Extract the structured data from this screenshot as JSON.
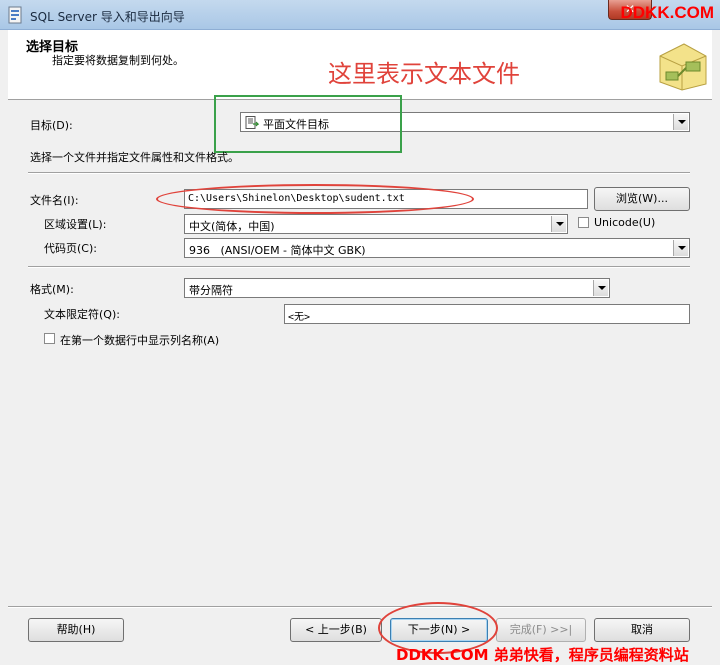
{
  "window": {
    "title": "SQL Server 导入和导出向导",
    "close_label": "✕"
  },
  "watermark": {
    "top": "DDKK.COM",
    "bottom": "DDKK.COM 弟弟快看，程序员编程资料站"
  },
  "header": {
    "title": "选择目标",
    "subtitle": "指定要将数据复制到何处。",
    "annotation": "这里表示文本文件"
  },
  "form": {
    "target_label": "目标(D):",
    "target_value": "平面文件目标",
    "instruction": "选择一个文件并指定文件属性和文件格式。",
    "filename_label": "文件名(I):",
    "filename_value": "C:\\Users\\Shinelon\\Desktop\\sudent.txt",
    "browse_label": "浏览(W)...",
    "locale_label": "区域设置(L):",
    "locale_value": "中文(简体，中国)",
    "unicode_label": "Unicode(U)",
    "codepage_label": "代码页(C):",
    "codepage_value": "936   (ANSI/OEM - 简体中文 GBK)",
    "format_label": "格式(M):",
    "format_value": "带分隔符",
    "qualifier_label": "文本限定符(Q):",
    "qualifier_value": "<无>",
    "header_row_label": "在第一个数据行中显示列名称(A)"
  },
  "buttons": {
    "help": "帮助(H)",
    "back": "< 上一步(B)",
    "next": "下一步(N) >",
    "finish": "完成(F) >>|",
    "cancel": "取消"
  },
  "colors": {
    "annotation_red": "#e0433b",
    "highlight_green": "#3aa14a",
    "watermark_red": "#ff0000"
  }
}
